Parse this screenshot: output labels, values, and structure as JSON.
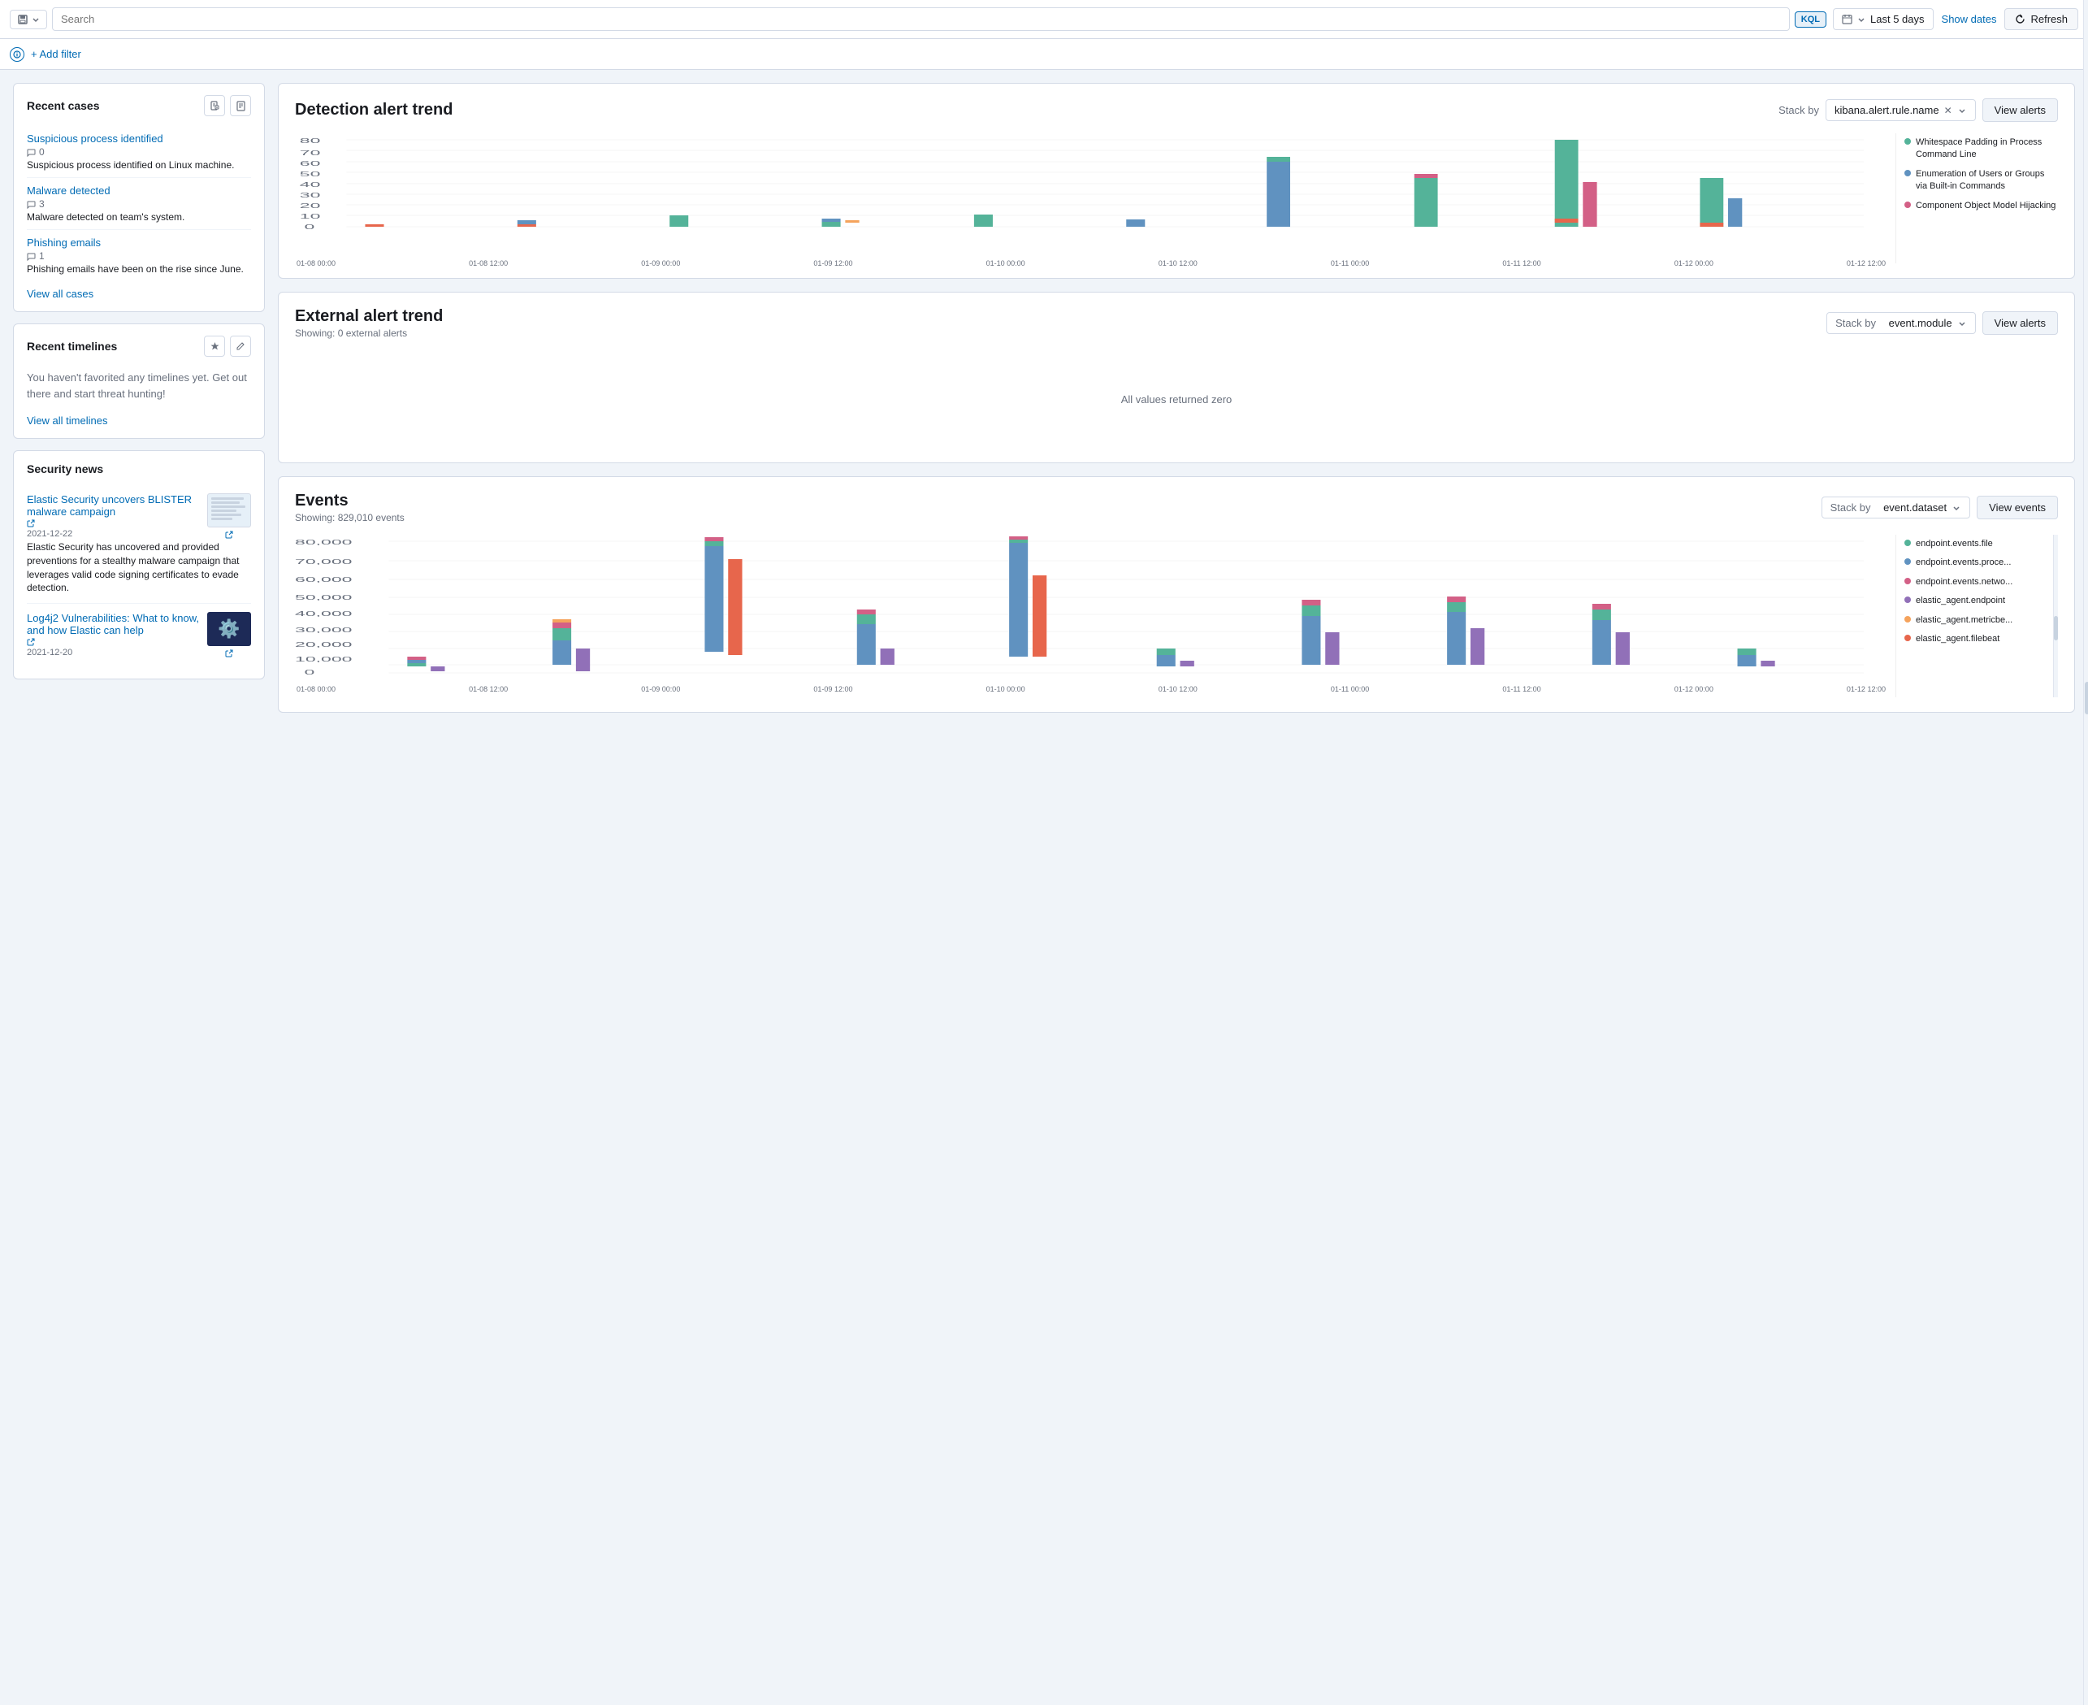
{
  "topbar": {
    "search_placeholder": "Search",
    "kql_label": "KQL",
    "date_range": "Last 5 days",
    "show_dates_label": "Show dates",
    "refresh_label": "Refresh"
  },
  "filterbar": {
    "add_filter_label": "+ Add filter"
  },
  "sidebar": {
    "recent_cases_title": "Recent cases",
    "cases": [
      {
        "title": "Suspicious process identified",
        "comments": "0",
        "description": "Suspicious process identified on Linux machine."
      },
      {
        "title": "Malware detected",
        "comments": "3",
        "description": "Malware detected on team's system."
      },
      {
        "title": "Phishing emails",
        "comments": "1",
        "description": "Phishing emails have been on the rise since June."
      }
    ],
    "view_all_cases_label": "View all cases",
    "recent_timelines_title": "Recent timelines",
    "timelines_empty_message": "You haven't favorited any timelines yet. Get out there and start threat hunting!",
    "view_all_timelines_label": "View all timelines",
    "security_news_title": "Security news",
    "news": [
      {
        "title": "Elastic Security uncovers BLISTER malware campaign",
        "date": "2021-12-22",
        "description": "Elastic Security has uncovered and provided preventions for a stealthy malware campaign that leverages valid code signing certificates to evade detection."
      },
      {
        "title": "Log4j2 Vulnerabilities: What to know, and how Elastic can help",
        "date": "2021-12-20",
        "description": ""
      }
    ]
  },
  "detection_alert": {
    "title": "Detection alert trend",
    "stack_label": "Stack by",
    "stack_value": "kibana.alert.rule.name",
    "view_alerts_label": "View alerts",
    "legend": [
      {
        "color": "#54b399",
        "label": "Whitespace Padding in Process Command Line"
      },
      {
        "color": "#6092c0",
        "label": "Enumeration of Users or Groups via Built-in Commands"
      },
      {
        "color": "#d36086",
        "label": "Component Object Model Hijacking"
      }
    ],
    "x_labels": [
      "01-08 00:00",
      "01-08 12:00",
      "01-09 00:00",
      "01-09 12:00",
      "01-10 00:00",
      "01-10 12:00",
      "01-11 00:00",
      "01-11 12:00",
      "01-12 00:00",
      "01-12 12:00"
    ]
  },
  "external_alert": {
    "title": "External alert trend",
    "stack_label": "Stack by",
    "stack_value": "event.module",
    "view_alerts_label": "View alerts",
    "subtitle": "Showing: 0 external alerts",
    "zero_message": "All values returned zero"
  },
  "events": {
    "title": "Events",
    "subtitle": "Showing: 829,010 events",
    "stack_label": "Stack by",
    "stack_value": "event.dataset",
    "view_events_label": "View events",
    "legend": [
      {
        "color": "#54b399",
        "label": "endpoint.events.file"
      },
      {
        "color": "#6092c0",
        "label": "endpoint.events.proce..."
      },
      {
        "color": "#d36086",
        "label": "endpoint.events.netwo..."
      },
      {
        "color": "#9170b8",
        "label": "elastic_agent.endpoint"
      },
      {
        "color": "#f5a35c",
        "label": "elastic_agent.metricbe..."
      },
      {
        "color": "#e7664c",
        "label": "elastic_agent.filebeat"
      }
    ],
    "x_labels": [
      "01-08 00:00",
      "01-08 12:00",
      "01-09 00:00",
      "01-09 12:00",
      "01-10 00:00",
      "01-10 12:00",
      "01-11 00:00",
      "01-11 12:00",
      "01-12 00:00",
      "01-12 12:00"
    ]
  }
}
